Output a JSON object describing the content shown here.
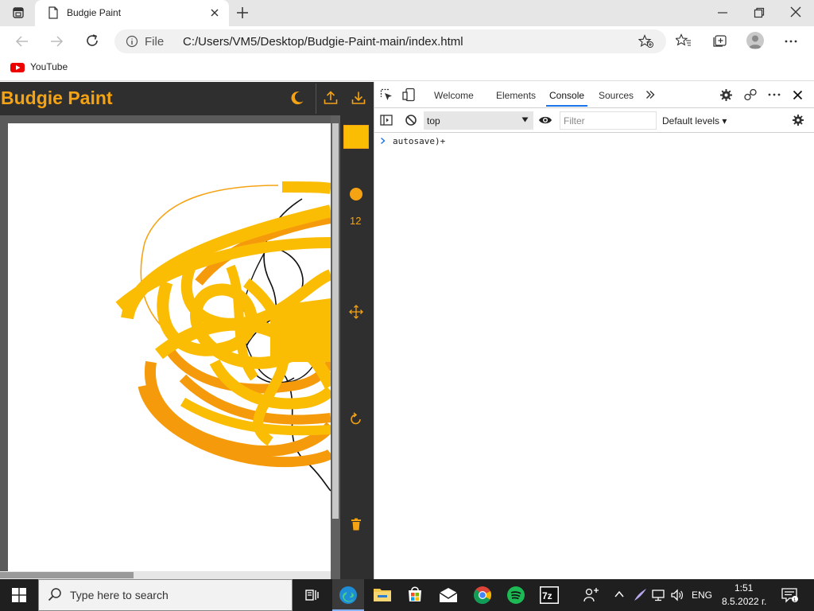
{
  "browser": {
    "tab_title": "Budgie Paint",
    "file_label": "File",
    "url": "C:/Users/VM5/Desktop/Budgie-Paint-main/index.html",
    "favorites": [
      {
        "label": "YouTube",
        "icon": "youtube-icon"
      }
    ]
  },
  "app": {
    "title": "Budgie Paint",
    "brush_size": "12",
    "colors": {
      "accent": "#f5a313",
      "swatch": "#fbbc04",
      "header_bg": "#2f2f2f"
    }
  },
  "devtools": {
    "tabs": [
      "Welcome",
      "Elements",
      "Console",
      "Sources"
    ],
    "active_tab": "Console",
    "context": "top",
    "filter_placeholder": "Filter",
    "levels": "Default levels ▾",
    "console_lines": [
      "autosave)+"
    ]
  },
  "taskbar": {
    "search_placeholder": "Type here to search",
    "language": "ENG",
    "time": "1:51",
    "date": "8.5.2022 г."
  }
}
